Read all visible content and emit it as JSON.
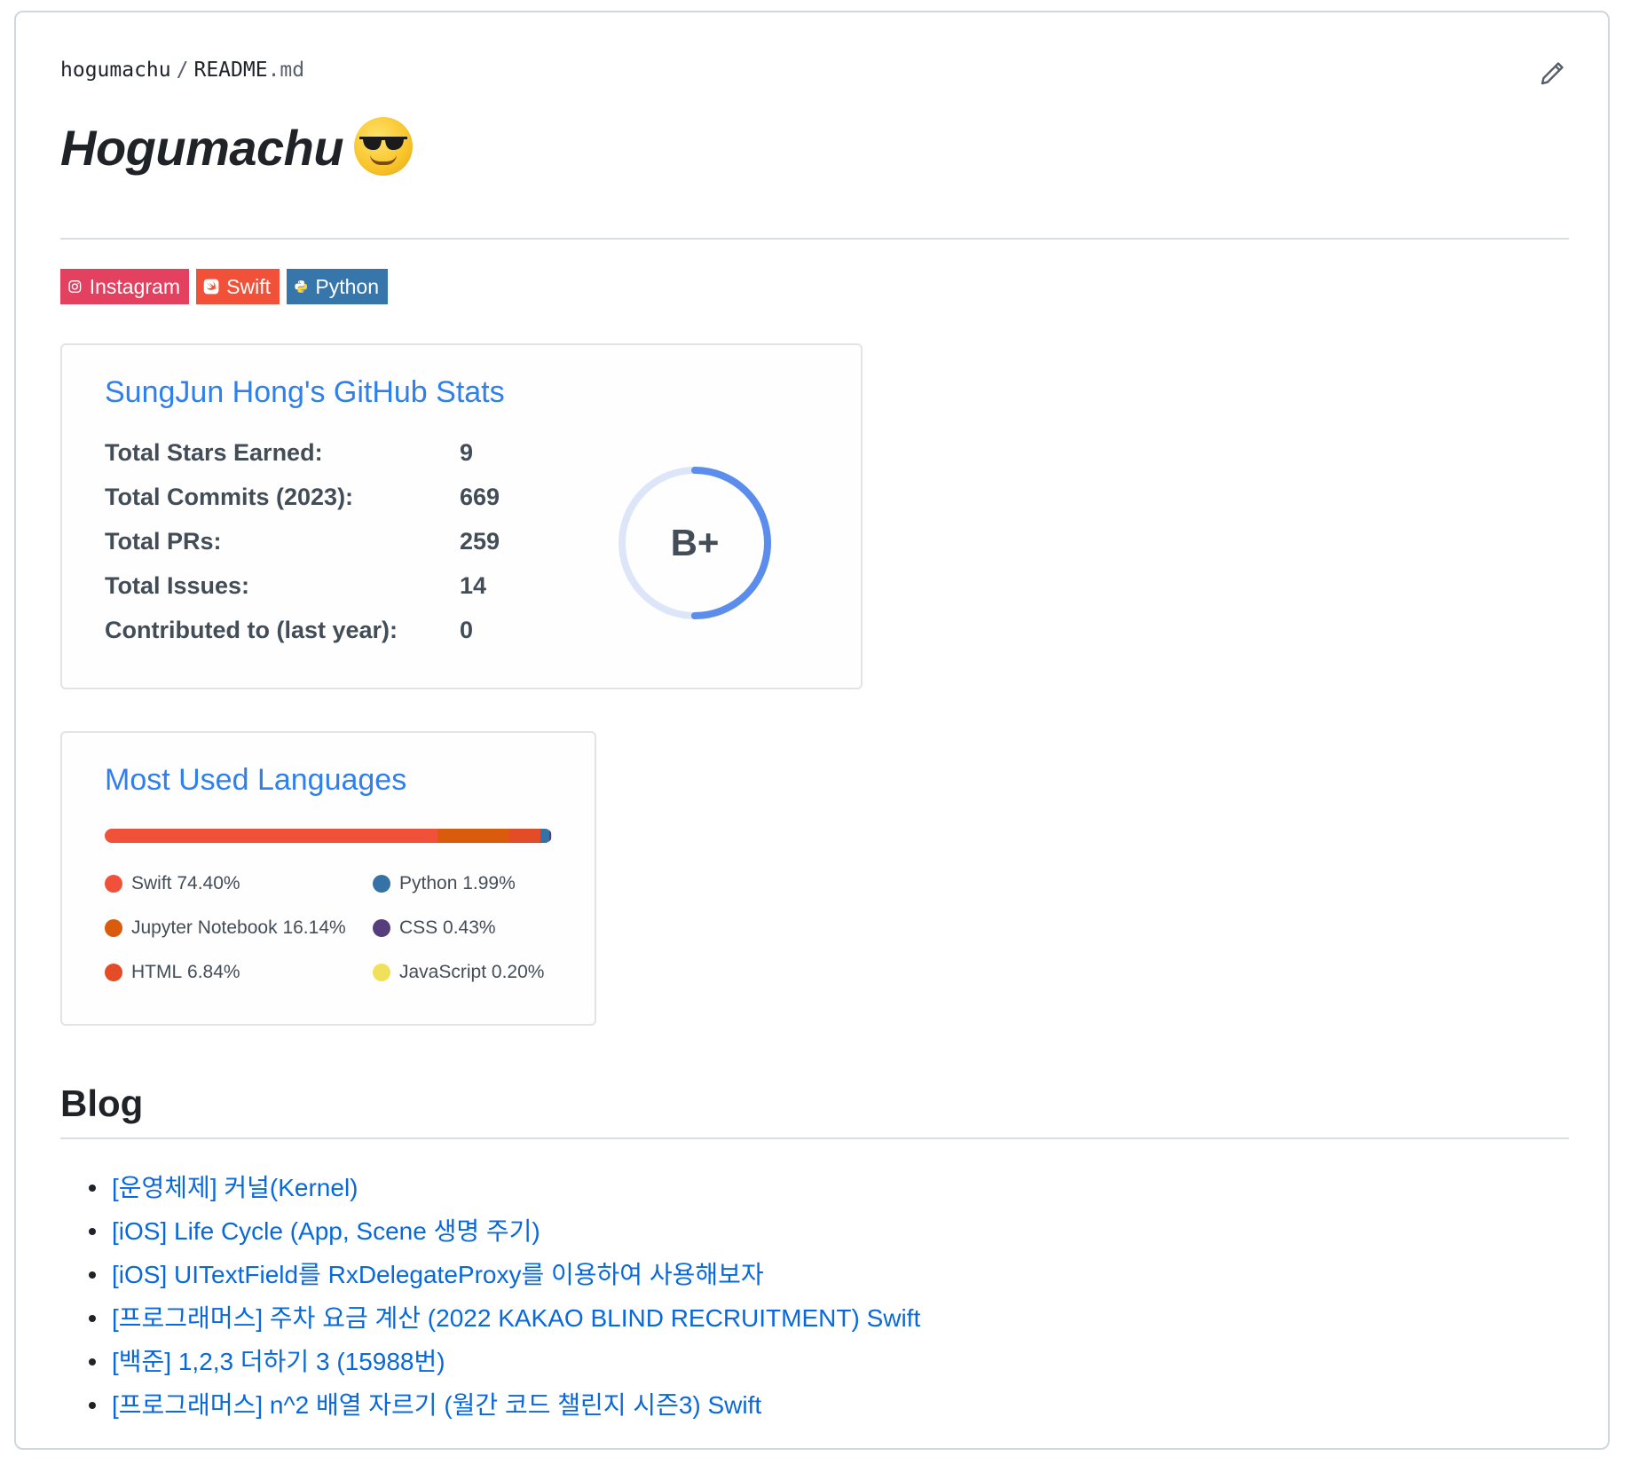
{
  "breadcrumb": {
    "user": "hogumachu",
    "separator": "/",
    "file_base": "README",
    "file_ext": ".md"
  },
  "edit_icon": "pencil-icon",
  "title": "Hogumachu",
  "title_emoji": "smiling-face-with-sunglasses-icon",
  "badges": [
    {
      "label": "Instagram",
      "icon": "instagram-icon",
      "color": "#E4405F"
    },
    {
      "label": "Swift",
      "icon": "swift-icon",
      "color": "#F05138"
    },
    {
      "label": "Python",
      "icon": "python-icon",
      "color": "#3776AB"
    }
  ],
  "stats_card": {
    "title": "SungJun Hong's GitHub Stats",
    "title_color": "#2f80ed",
    "rows": [
      {
        "label": "Total Stars Earned:",
        "value": "9"
      },
      {
        "label": "Total Commits (2023):",
        "value": "669"
      },
      {
        "label": "Total PRs:",
        "value": "259"
      },
      {
        "label": "Total Issues:",
        "value": "14"
      },
      {
        "label": "Contributed to (last year):",
        "value": "0"
      }
    ],
    "rank": "B+",
    "rank_progress": 0.5,
    "rank_color": "#5b8ded"
  },
  "languages_card": {
    "title": "Most Used Languages",
    "languages": [
      {
        "name": "Swift",
        "percent_text": "74.40%",
        "percent": 74.4,
        "color": "#F05138"
      },
      {
        "name": "Jupyter Notebook",
        "percent_text": "16.14%",
        "percent": 16.14,
        "color": "#DA5B0B"
      },
      {
        "name": "HTML",
        "percent_text": "6.84%",
        "percent": 6.84,
        "color": "#E34C26"
      },
      {
        "name": "Python",
        "percent_text": "1.99%",
        "percent": 1.99,
        "color": "#3572A5"
      },
      {
        "name": "CSS",
        "percent_text": "0.43%",
        "percent": 0.43,
        "color": "#563D7C"
      },
      {
        "name": "JavaScript",
        "percent_text": "0.20%",
        "percent": 0.2,
        "color": "#F1E05A"
      }
    ]
  },
  "blog": {
    "heading": "Blog",
    "posts": [
      "[운영체제] 커널(Kernel)",
      "[iOS] Life Cycle (App, Scene 생명 주기)",
      "[iOS] UITextField를 RxDelegateProxy를 이용하여 사용해보자",
      "[프로그래머스] 주차 요금 계산 (2022 KAKAO BLIND RECRUITMENT) Swift",
      "[백준] 1,2,3 더하기 3 (15988번)",
      "[프로그래머스] n^2 배열 자르기 (월간 코드 챌린지 시즌3) Swift"
    ]
  }
}
